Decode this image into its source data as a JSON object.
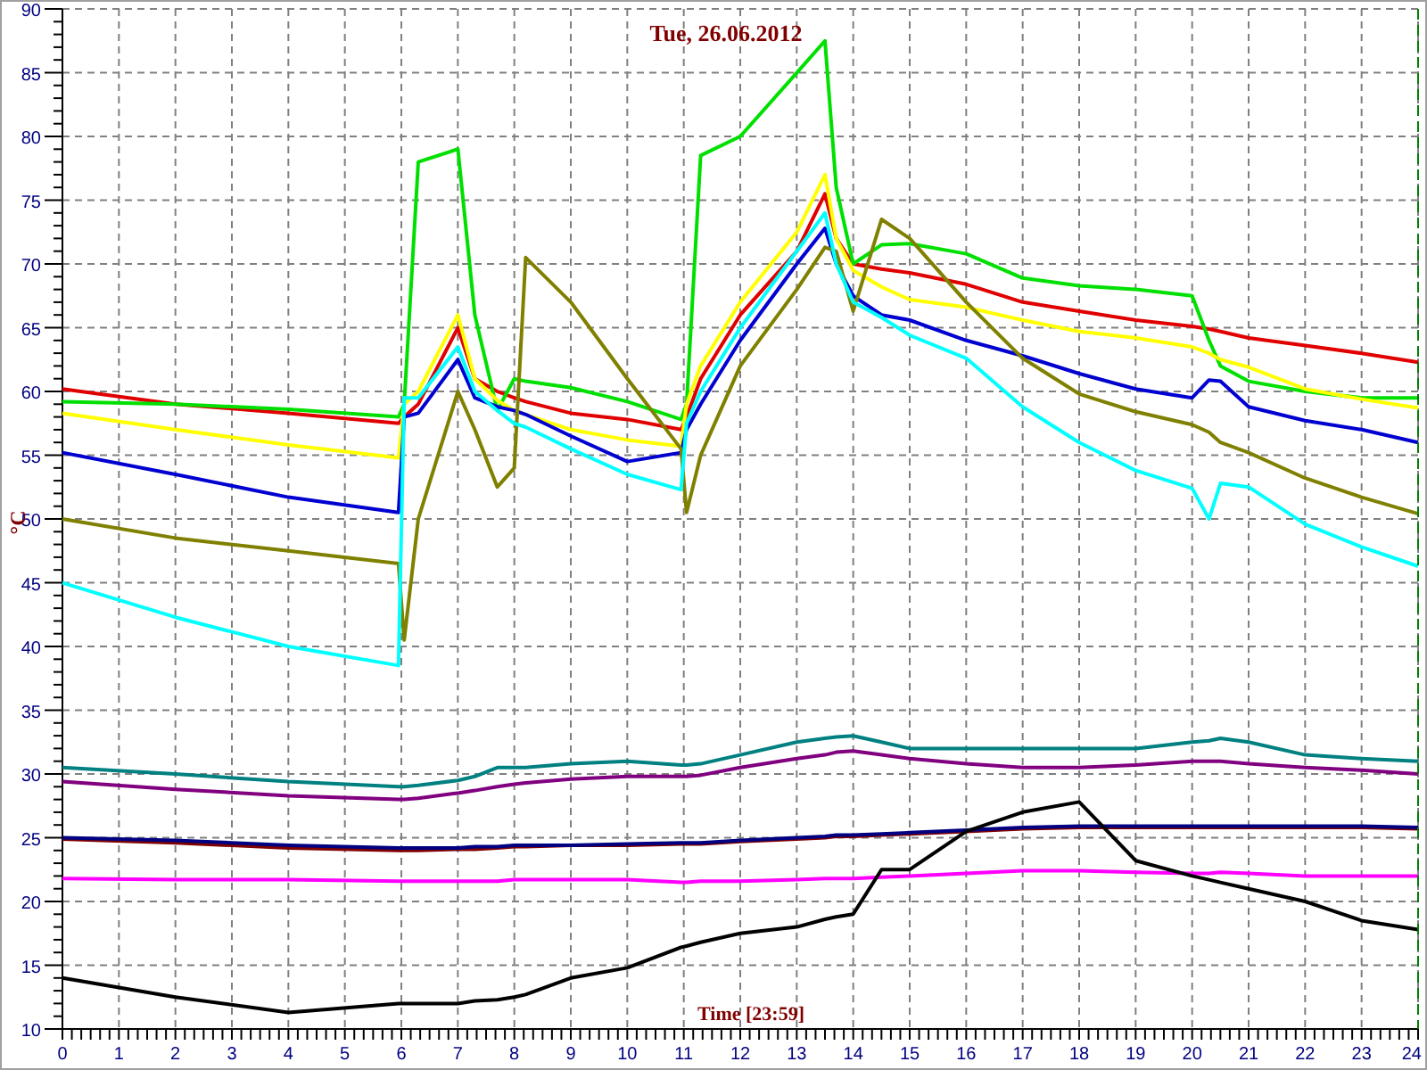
{
  "chart": {
    "chart_data": {
      "type": "line",
      "grid": true,
      "title": "Tue, 26.06.2012",
      "xlabel": "Time [23:59]",
      "ylabel": "°C",
      "xlim": [
        0,
        24
      ],
      "ylim": [
        10,
        90
      ],
      "xticks": [
        0,
        1,
        2,
        3,
        4,
        5,
        6,
        7,
        8,
        9,
        10,
        11,
        12,
        13,
        14,
        15,
        16,
        17,
        18,
        19,
        20,
        21,
        22,
        23,
        24
      ],
      "yticks": [
        10,
        15,
        20,
        25,
        30,
        35,
        40,
        45,
        50,
        55,
        60,
        65,
        70,
        75,
        80,
        85,
        90
      ],
      "x": [
        0,
        2,
        4,
        5.95,
        6.05,
        6.3,
        7,
        7.3,
        7.7,
        8,
        8.2,
        9,
        10,
        10.95,
        11.05,
        11.3,
        12,
        13,
        13.5,
        13.7,
        14,
        14.5,
        15,
        16,
        17,
        18,
        19,
        20,
        20.3,
        20.5,
        21,
        22,
        23,
        24
      ],
      "series": [
        {
          "color": "#e00000",
          "values": [
            60.2,
            59,
            58.3,
            57.5,
            58,
            59,
            65,
            61,
            60,
            59.5,
            59.2,
            58.3,
            57.8,
            57,
            58,
            61,
            66,
            71,
            75.5,
            72,
            70,
            69.6,
            69.3,
            68.4,
            67,
            66.3,
            65.6,
            65.1,
            64.9,
            64.7,
            64.2,
            63.6,
            63,
            62.3
          ]
        },
        {
          "color": "#00e000",
          "values": [
            59.2,
            59,
            58.6,
            58,
            59,
            78,
            79,
            66,
            58.5,
            61,
            60.8,
            60.3,
            59.2,
            57.8,
            59,
            78.5,
            80,
            85,
            87.5,
            76,
            70,
            71.5,
            71.6,
            70.8,
            68.9,
            68.3,
            68,
            67.5,
            64,
            62,
            60.8,
            60,
            59.5,
            59.5
          ]
        },
        {
          "color": "#ffff00",
          "values": [
            58.3,
            57,
            55.8,
            54.8,
            59,
            60,
            66,
            61,
            59.3,
            58.5,
            58.2,
            57,
            56.2,
            55.7,
            59,
            62,
            67,
            72.5,
            77,
            72,
            69.5,
            68.2,
            67.2,
            66.6,
            65.6,
            64.7,
            64.2,
            63.5,
            63,
            62.5,
            61.9,
            60.2,
            59.4,
            58.7
          ]
        },
        {
          "color": "#0000d0",
          "values": [
            55.2,
            53.5,
            51.7,
            50.5,
            58,
            58.3,
            62.5,
            59.5,
            58.8,
            58.5,
            58.2,
            56.5,
            54.5,
            55.2,
            57,
            59,
            64,
            70,
            72.8,
            70,
            67.5,
            66,
            65.6,
            64,
            62.8,
            61.4,
            60.2,
            59.5,
            60.9,
            60.8,
            58.8,
            57.7,
            57,
            56
          ]
        },
        {
          "color": "#808000",
          "values": [
            50,
            48.5,
            47.5,
            46.5,
            40.5,
            50,
            60,
            57,
            52.5,
            54,
            70.5,
            67,
            61,
            55.5,
            50.5,
            55,
            62,
            68,
            71.3,
            71,
            66.3,
            73.5,
            72,
            67,
            62.6,
            59.8,
            58.4,
            57.4,
            56.8,
            56,
            55.2,
            53.2,
            51.7,
            50.4
          ]
        },
        {
          "color": "#00ffff",
          "values": [
            45,
            42.3,
            40,
            38.5,
            59.5,
            59.5,
            63.5,
            60,
            58.5,
            57.5,
            57.2,
            55.5,
            53.5,
            52.3,
            57.5,
            60,
            65,
            71,
            74,
            70,
            67,
            65.8,
            64.4,
            62.6,
            58.8,
            56,
            53.8,
            52.4,
            50,
            52.8,
            52.5,
            49.6,
            47.8,
            46.3
          ]
        },
        {
          "color": "#008080",
          "values": [
            30.5,
            30,
            29.4,
            29,
            29,
            29.1,
            29.5,
            29.8,
            30.5,
            30.5,
            30.5,
            30.8,
            31,
            30.7,
            30.7,
            30.8,
            31.5,
            32.5,
            32.8,
            32.9,
            33,
            32.5,
            32,
            32,
            32,
            32,
            32,
            32.5,
            32.6,
            32.8,
            32.5,
            31.5,
            31.2,
            31
          ]
        },
        {
          "color": "#800080",
          "values": [
            29.4,
            28.8,
            28.3,
            28,
            28,
            28.1,
            28.5,
            28.7,
            29,
            29.2,
            29.3,
            29.6,
            29.8,
            29.8,
            29.8,
            29.9,
            30.5,
            31.2,
            31.5,
            31.7,
            31.8,
            31.5,
            31.2,
            30.8,
            30.5,
            30.5,
            30.7,
            31,
            31,
            31,
            30.8,
            30.5,
            30.3,
            30
          ]
        },
        {
          "color": "#800000",
          "values": [
            24.9,
            24.6,
            24.2,
            24,
            24,
            24,
            24.1,
            24.1,
            24.2,
            24.3,
            24.3,
            24.4,
            24.4,
            24.5,
            24.5,
            24.5,
            24.7,
            24.9,
            25,
            25.1,
            25.1,
            25.2,
            25.3,
            25.5,
            25.7,
            25.8,
            25.8,
            25.8,
            25.8,
            25.8,
            25.8,
            25.8,
            25.8,
            25.7
          ]
        },
        {
          "color": "#000080",
          "values": [
            25,
            24.8,
            24.4,
            24.2,
            24.2,
            24.2,
            24.2,
            24.3,
            24.3,
            24.4,
            24.4,
            24.4,
            24.5,
            24.6,
            24.6,
            24.6,
            24.8,
            25,
            25.1,
            25.2,
            25.2,
            25.3,
            25.4,
            25.6,
            25.8,
            25.9,
            25.9,
            25.9,
            25.9,
            25.9,
            25.9,
            25.9,
            25.9,
            25.8
          ]
        },
        {
          "color": "#ff00ff",
          "values": [
            21.8,
            21.7,
            21.7,
            21.6,
            21.6,
            21.6,
            21.6,
            21.6,
            21.6,
            21.7,
            21.7,
            21.7,
            21.7,
            21.5,
            21.5,
            21.6,
            21.6,
            21.7,
            21.8,
            21.8,
            21.8,
            21.9,
            22,
            22.2,
            22.4,
            22.4,
            22.3,
            22.2,
            22.2,
            22.3,
            22.2,
            22,
            22,
            22
          ]
        },
        {
          "color": "#000000",
          "values": [
            14,
            12.5,
            11.3,
            12,
            12,
            12,
            12,
            12.2,
            12.3,
            12.5,
            12.7,
            14,
            14.8,
            16.4,
            16.5,
            16.8,
            17.5,
            18,
            18.6,
            18.8,
            19,
            22.5,
            22.5,
            25.5,
            27,
            27.8,
            23.2,
            22,
            21.7,
            21.5,
            21,
            20,
            18.5,
            17.8
          ]
        }
      ]
    }
  }
}
